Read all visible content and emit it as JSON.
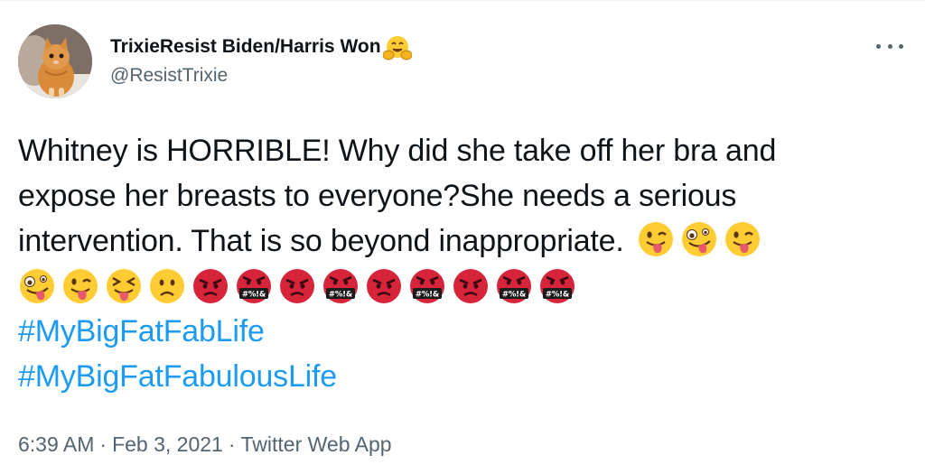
{
  "author": {
    "display_name": "TrixieResist Biden/Harris Won",
    "name_emoji": "hugging-face-icon",
    "handle": "@ResistTrixie",
    "avatar": "kitten-photo"
  },
  "tweet": {
    "lines": [
      "Whitney is HORRIBLE! Why did she take off her bra and",
      "expose her breasts to everyone?She needs a serious",
      "intervention. That is so beyond inappropriate."
    ],
    "line3_emojis": [
      "winking-tongue-face-icon",
      "zany-face-icon",
      "winking-tongue-face-icon"
    ],
    "emoji_row": [
      "zany-face-icon",
      "winking-tongue-face-icon",
      "squinting-tongue-face-icon",
      "frowning-face-icon",
      "angry-face-icon",
      "cursing-face-icon",
      "angry-face-icon",
      "cursing-face-icon",
      "angry-face-icon",
      "cursing-face-icon",
      "angry-face-icon",
      "cursing-face-icon",
      "cursing-face-icon"
    ],
    "cursing_symbols": "#%!&",
    "hashtags": [
      "#MyBigFatFabLife",
      "#MyBigFatFabulousLife"
    ]
  },
  "meta": {
    "time": "6:39 AM",
    "separator": "·",
    "date": "Feb 3, 2021",
    "source": "Twitter Web App"
  },
  "colors": {
    "link": "#1d9bf0",
    "secondary_text": "#536471",
    "primary_text": "#0f1419",
    "emoji_yellow": "#ffcc33",
    "emoji_red": "#d6243a"
  }
}
